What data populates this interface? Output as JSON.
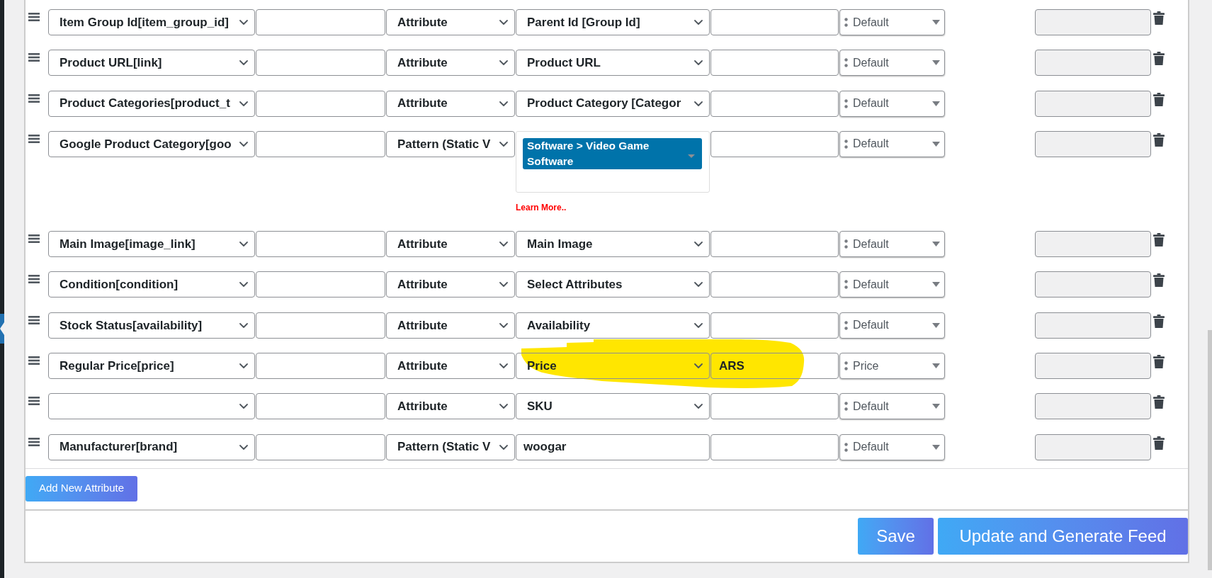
{
  "rows": [
    {
      "kind": "select",
      "column_1": "Item Group Id[item_group_id]",
      "column_3": "Attribute",
      "column_4": "Parent Id [Group Id]",
      "column_6": "Default",
      "column_7_disabled": true,
      "highlighted": false
    },
    {
      "kind": "select",
      "column_1": "Product URL[link]",
      "column_3": "Attribute",
      "column_4": "Product URL",
      "column_6": "Default",
      "column_7_disabled": true,
      "highlighted": false
    },
    {
      "kind": "select",
      "column_1": "Product Categories[product_t",
      "column_3": "Attribute",
      "column_4": "Product Category [Categor",
      "column_6": "Default",
      "column_7_disabled": true,
      "highlighted": false
    },
    {
      "kind": "multiselect",
      "column_1": "Google Product Category[goo",
      "column_3": "Pattern (Static V",
      "column_4": "Software > Video Game Software",
      "column_4_link": "Learn More..",
      "column_6": "Default",
      "column_7_disabled": true,
      "highlighted": false
    },
    {
      "kind": "select",
      "column_1": "Main Image[image_link]",
      "column_3": "Attribute",
      "column_4": "Main Image",
      "column_6": "Default",
      "column_7_disabled": true,
      "highlighted": false
    },
    {
      "kind": "select",
      "column_1": "Condition[condition]",
      "column_3": "Attribute",
      "column_4": "Select Attributes",
      "column_6": "Default",
      "column_7_disabled": true,
      "highlighted": false
    },
    {
      "kind": "select",
      "column_1": "Stock Status[availability]",
      "column_3": "Attribute",
      "column_4": "Availability",
      "column_6": "Default",
      "column_7_disabled": true,
      "highlighted": false
    },
    {
      "kind": "select",
      "column_1": "Regular Price[price]",
      "column_3": "Attribute",
      "column_4": "Price",
      "column_5": "ARS",
      "column_6": "Price",
      "column_7_disabled": true,
      "highlighted": true
    },
    {
      "kind": "select",
      "column_3": "Attribute",
      "column_4": "SKU",
      "column_6": "Default",
      "column_7_disabled": true,
      "highlighted": false
    },
    {
      "kind": "input",
      "column_1": "Manufacturer[brand]",
      "column_3": "Pattern (Static V",
      "column_4": "woogar",
      "column_6": "Default",
      "column_7_disabled": true,
      "highlighted": false
    }
  ],
  "add_button": "Add New Attribute",
  "buttons": [
    "Save",
    "Update and Generate Feed"
  ]
}
